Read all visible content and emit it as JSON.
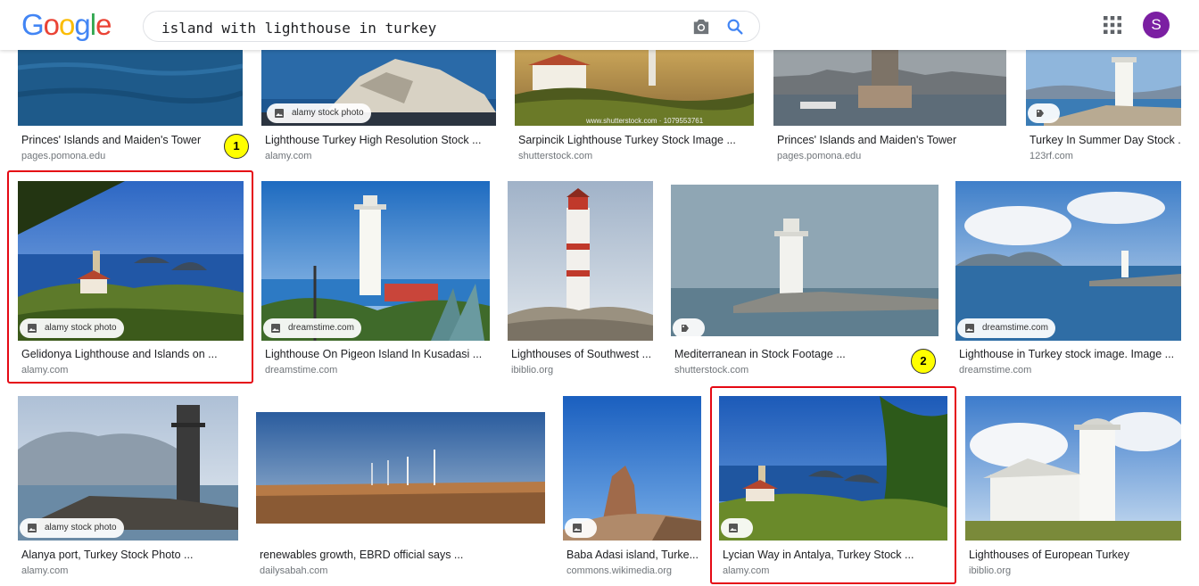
{
  "header": {
    "logo_letters": [
      {
        "ch": "G",
        "color": "#4285F4"
      },
      {
        "ch": "o",
        "color": "#EA4335"
      },
      {
        "ch": "o",
        "color": "#FBBC05"
      },
      {
        "ch": "g",
        "color": "#4285F4"
      },
      {
        "ch": "l",
        "color": "#34A853"
      },
      {
        "ch": "e",
        "color": "#EA4335"
      }
    ],
    "search_value": "island with lighthouse in turkey",
    "avatar_letter": "S"
  },
  "watermarks": {
    "alamy": "alamy stock photo",
    "dreamstime": "dreamstime.com",
    "shutterstock": "www.shutterstock.com · 1079553761"
  },
  "results": [
    {
      "title": "Princes' Islands and Maiden's Tower",
      "source": "pages.pomona.edu"
    },
    {
      "title": "Lighthouse Turkey High Resolution Stock ...",
      "source": "alamy.com"
    },
    {
      "title": "Sarpincik Lighthouse Turkey Stock Image ...",
      "source": "shutterstock.com"
    },
    {
      "title": "Princes' Islands and Maiden's Tower",
      "source": "pages.pomona.edu"
    },
    {
      "title": "Turkey In Summer Day Stock ...",
      "source": "123rf.com"
    },
    {
      "title": "Gelidonya Lighthouse and Islands on ...",
      "source": "alamy.com"
    },
    {
      "title": "Lighthouse On Pigeon Island In Kusadasi ...",
      "source": "dreamstime.com"
    },
    {
      "title": "Lighthouses of Southwest ...",
      "source": "ibiblio.org"
    },
    {
      "title": "Mediterranean in Stock Footage ...",
      "source": "shutterstock.com"
    },
    {
      "title": "Lighthouse in Turkey stock image. Image ...",
      "source": "dreamstime.com"
    },
    {
      "title": "Alanya port, Turkey Stock Photo ...",
      "source": "alamy.com"
    },
    {
      "title": "renewables growth, EBRD official says ...",
      "source": "dailysabah.com"
    },
    {
      "title": "Baba Adasi island, Turke...",
      "source": "commons.wikimedia.org"
    },
    {
      "title": "Lycian Way in Antalya, Turkey Stock ...",
      "source": "alamy.com"
    },
    {
      "title": "Lighthouses of European Turkey",
      "source": "ibiblio.org"
    }
  ],
  "markers": [
    "1",
    "2"
  ]
}
